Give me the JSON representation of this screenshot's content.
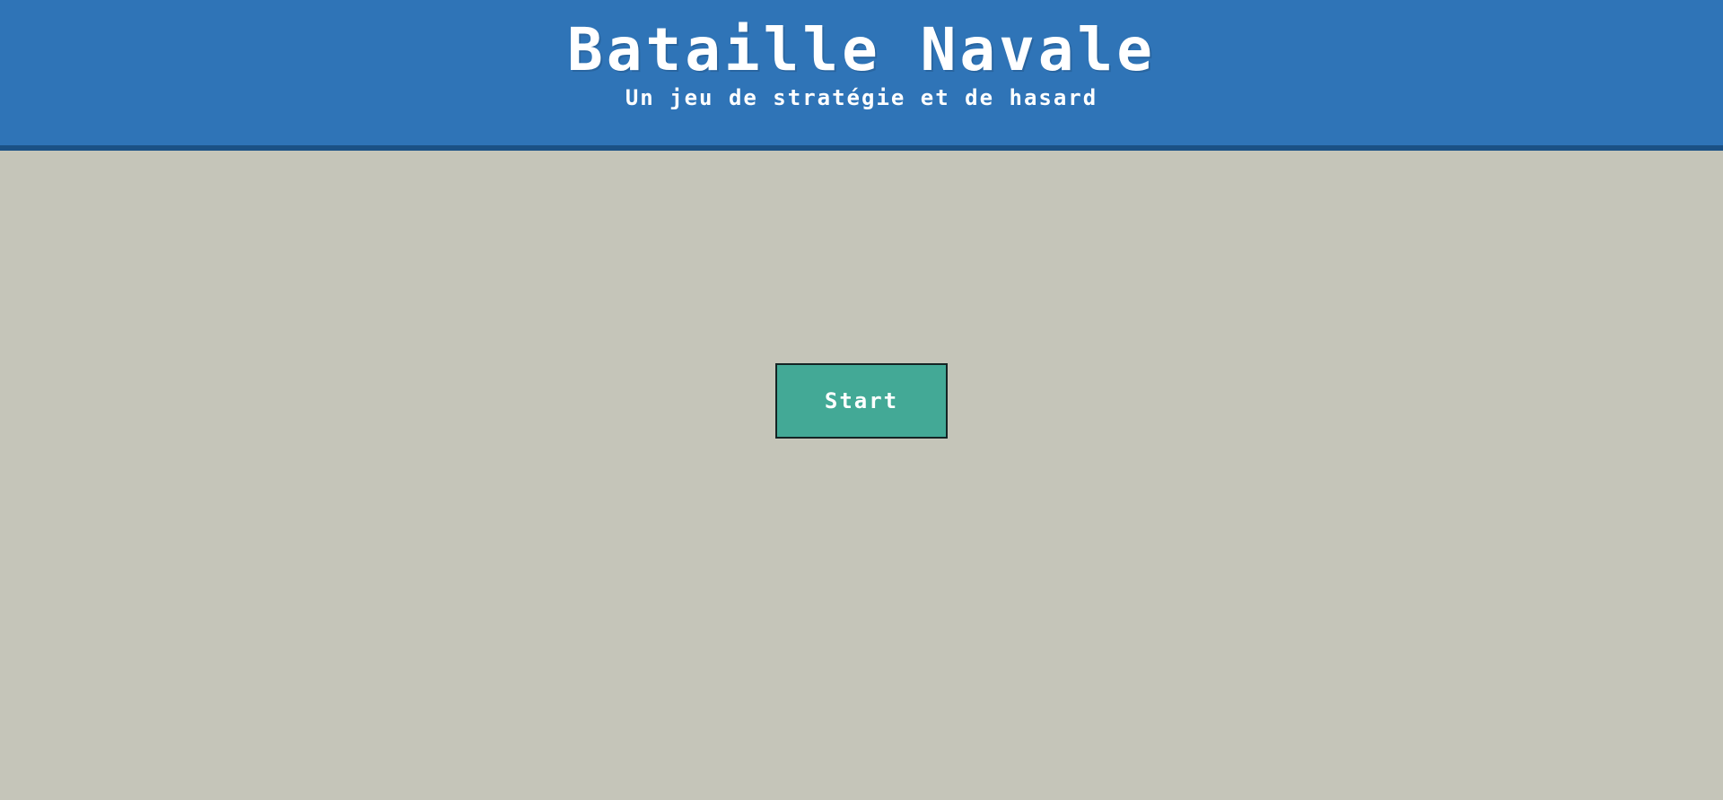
{
  "header": {
    "title": "Bataille Navale",
    "subtitle": "Un jeu de stratégie et de hasard"
  },
  "main": {
    "start_label": "Start"
  },
  "colors": {
    "header_bg": "#2f74b7",
    "header_border": "#1b5185",
    "page_bg": "#c5c5b9",
    "button_bg": "#43a996",
    "button_border": "#142424",
    "text": "#ffffff"
  }
}
